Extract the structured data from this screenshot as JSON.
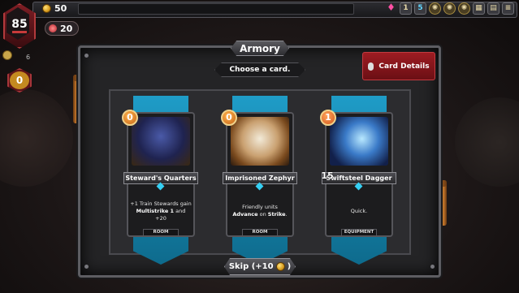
{
  "hud": {
    "gold": "50",
    "health": "85",
    "ember": "20",
    "deck_count": "6",
    "shards": "0",
    "top_counters": [
      "1",
      "5"
    ]
  },
  "armory": {
    "title": "Armory",
    "subtitle": "Choose a card.",
    "card_details_label": "Card Details",
    "skip_label": "Skip (+10"
  },
  "cards": [
    {
      "cost": "0",
      "name": "Steward's Quarters",
      "text_prefix": "+1",
      "text_main": " Train Stewards gain ",
      "text_bold": "Multistrike 1",
      "text_suffix": " and +20",
      "type": "ROOM"
    },
    {
      "cost": "0",
      "name": "Imprisoned Zephyr",
      "text_main": "Friendly units ",
      "text_bold": "Advance",
      "text_mid": " on ",
      "text_bold2": "Strike",
      "text_suffix": ".",
      "type": "ROOM"
    },
    {
      "cost": "1",
      "name": "Swiftsteel Dagger",
      "attack": "15",
      "text_main": "Quick.",
      "type": "EQUIPMENT"
    }
  ],
  "colors": {
    "banner": "#1f9cc7",
    "details_button": "#9e1c22",
    "panel": "#242426"
  }
}
